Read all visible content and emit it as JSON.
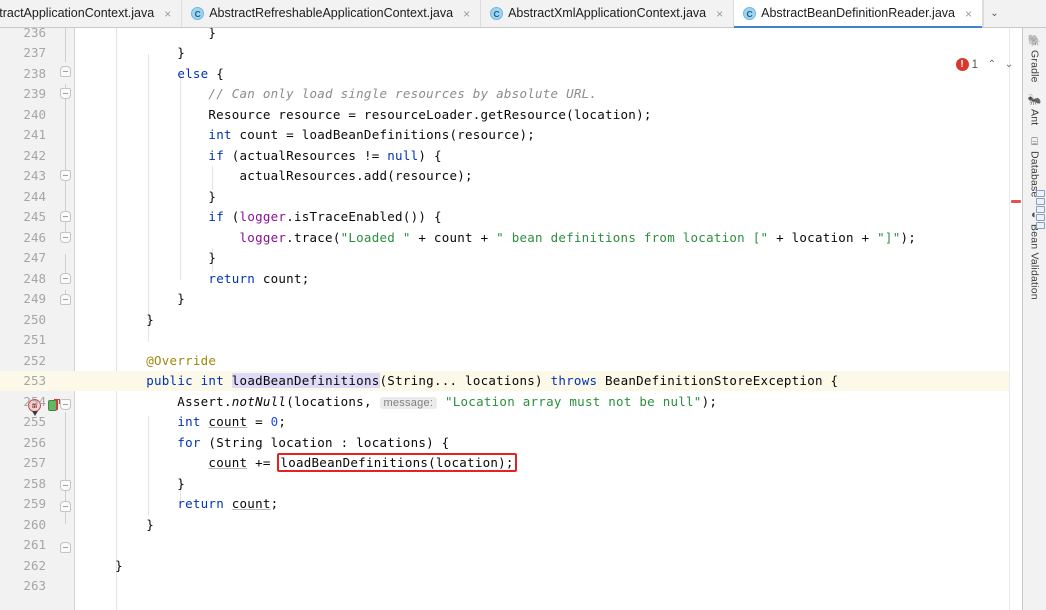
{
  "tabs": [
    {
      "label": "stractApplicationContext.java",
      "icon": "class-icon",
      "active": false,
      "truncated": true,
      "close": "×"
    },
    {
      "label": "AbstractRefreshableApplicationContext.java",
      "icon": "class-icon",
      "active": false,
      "truncated": false,
      "close": "×"
    },
    {
      "label": "AbstractXmlApplicationContext.java",
      "icon": "class-icon",
      "active": false,
      "truncated": false,
      "close": "×"
    },
    {
      "label": "AbstractBeanDefinitionReader.java",
      "icon": "class-icon",
      "active": true,
      "truncated": false,
      "close": "×"
    }
  ],
  "tab_overflow": {
    "name": "tab-list-chevron",
    "glyph": "⌄"
  },
  "class_icon_letter": "C",
  "inspection": {
    "error_glyph": "!",
    "error_count": "1",
    "prev_glyph": "⌃",
    "next_glyph": "⌄"
  },
  "gutter": {
    "override_marker_letter": "m",
    "line_with_markers": "253"
  },
  "editor": {
    "first_line": 236,
    "last_line": 263,
    "caret_line": 253,
    "highlighted_identifier": "loadBeanDefinitions",
    "inlay_hint": "message:",
    "red_box_text": "loadBeanDefinitions(location);",
    "lines": [
      {
        "n": "236",
        "partial": true
      },
      {
        "n": "237"
      },
      {
        "n": "238"
      },
      {
        "n": "239"
      },
      {
        "n": "240"
      },
      {
        "n": "241"
      },
      {
        "n": "242"
      },
      {
        "n": "243"
      },
      {
        "n": "244"
      },
      {
        "n": "245"
      },
      {
        "n": "246"
      },
      {
        "n": "247"
      },
      {
        "n": "248"
      },
      {
        "n": "249"
      },
      {
        "n": "250"
      },
      {
        "n": "251"
      },
      {
        "n": "252"
      },
      {
        "n": "253"
      },
      {
        "n": "254"
      },
      {
        "n": "255"
      },
      {
        "n": "256"
      },
      {
        "n": "257"
      },
      {
        "n": "258"
      },
      {
        "n": "259"
      },
      {
        "n": "260"
      },
      {
        "n": "261"
      },
      {
        "n": "262"
      },
      {
        "n": "263"
      }
    ],
    "source": {
      "l236": "}",
      "l237": "}",
      "l238": "else {",
      "l239": "// Can only load single resources by absolute URL.",
      "l240": "Resource resource = resourceLoader.getResource(location);",
      "l241": "int count = loadBeanDefinitions(resource);",
      "l242": "if (actualResources != null) {",
      "l243": "actualResources.add(resource);",
      "l244": "}",
      "l245": "if (logger.isTraceEnabled()) {",
      "l246": "logger.trace(\"Loaded \" + count + \" bean definitions from location [\" + location + \"]\");",
      "l247": "}",
      "l248": "return count;",
      "l249": "}",
      "l250": "}",
      "l252": "@Override",
      "l253": "public int loadBeanDefinitions(String... locations) throws BeanDefinitionStoreException {",
      "l254": "Assert.notNull(locations, message: \"Location array must not be null\");",
      "l255": "int count = 0;",
      "l256": "for (String location : locations) {",
      "l257": "count += loadBeanDefinitions(location);",
      "l258": "}",
      "l259": "return count;",
      "l260": "}",
      "l262": "}"
    }
  },
  "right_toolwindows": [
    {
      "label": "Gradle",
      "icon": "elephant-icon",
      "glyph": "🐘"
    },
    {
      "label": "Ant",
      "icon": "ant-icon",
      "glyph": "🐜"
    },
    {
      "label": "Database",
      "icon": "database-icon",
      "glyph": "⌸"
    },
    {
      "label": "Bean Validation",
      "icon": "bean-validation-icon",
      "glyph": "◐"
    }
  ]
}
